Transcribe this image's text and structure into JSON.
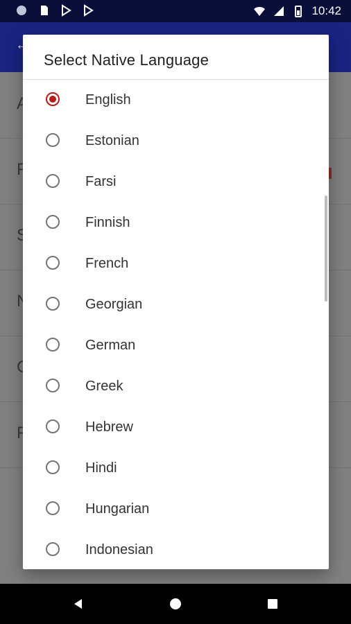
{
  "status_bar": {
    "time": "10:42",
    "left_icons": [
      "dot-icon",
      "sd-card-icon",
      "play-store-icon",
      "play-store-icon"
    ],
    "right_icons": [
      "wifi-icon",
      "signal-icon",
      "battery-icon"
    ]
  },
  "dialog": {
    "title": "Select Native Language",
    "options": [
      {
        "label": "English",
        "selected": true
      },
      {
        "label": "Estonian",
        "selected": false
      },
      {
        "label": "Farsi",
        "selected": false
      },
      {
        "label": "Finnish",
        "selected": false
      },
      {
        "label": "French",
        "selected": false
      },
      {
        "label": "Georgian",
        "selected": false
      },
      {
        "label": "German",
        "selected": false
      },
      {
        "label": "Greek",
        "selected": false
      },
      {
        "label": "Hebrew",
        "selected": false
      },
      {
        "label": "Hindi",
        "selected": false
      },
      {
        "label": "Hungarian",
        "selected": false
      },
      {
        "label": "Indonesian",
        "selected": false
      }
    ],
    "accent_color": "#b71c1c"
  },
  "background": {
    "row_letters": [
      "A",
      "F",
      "S",
      "N",
      "C",
      "F"
    ]
  },
  "nav_bar": {
    "buttons": [
      "back-icon",
      "home-icon",
      "recents-icon"
    ]
  }
}
